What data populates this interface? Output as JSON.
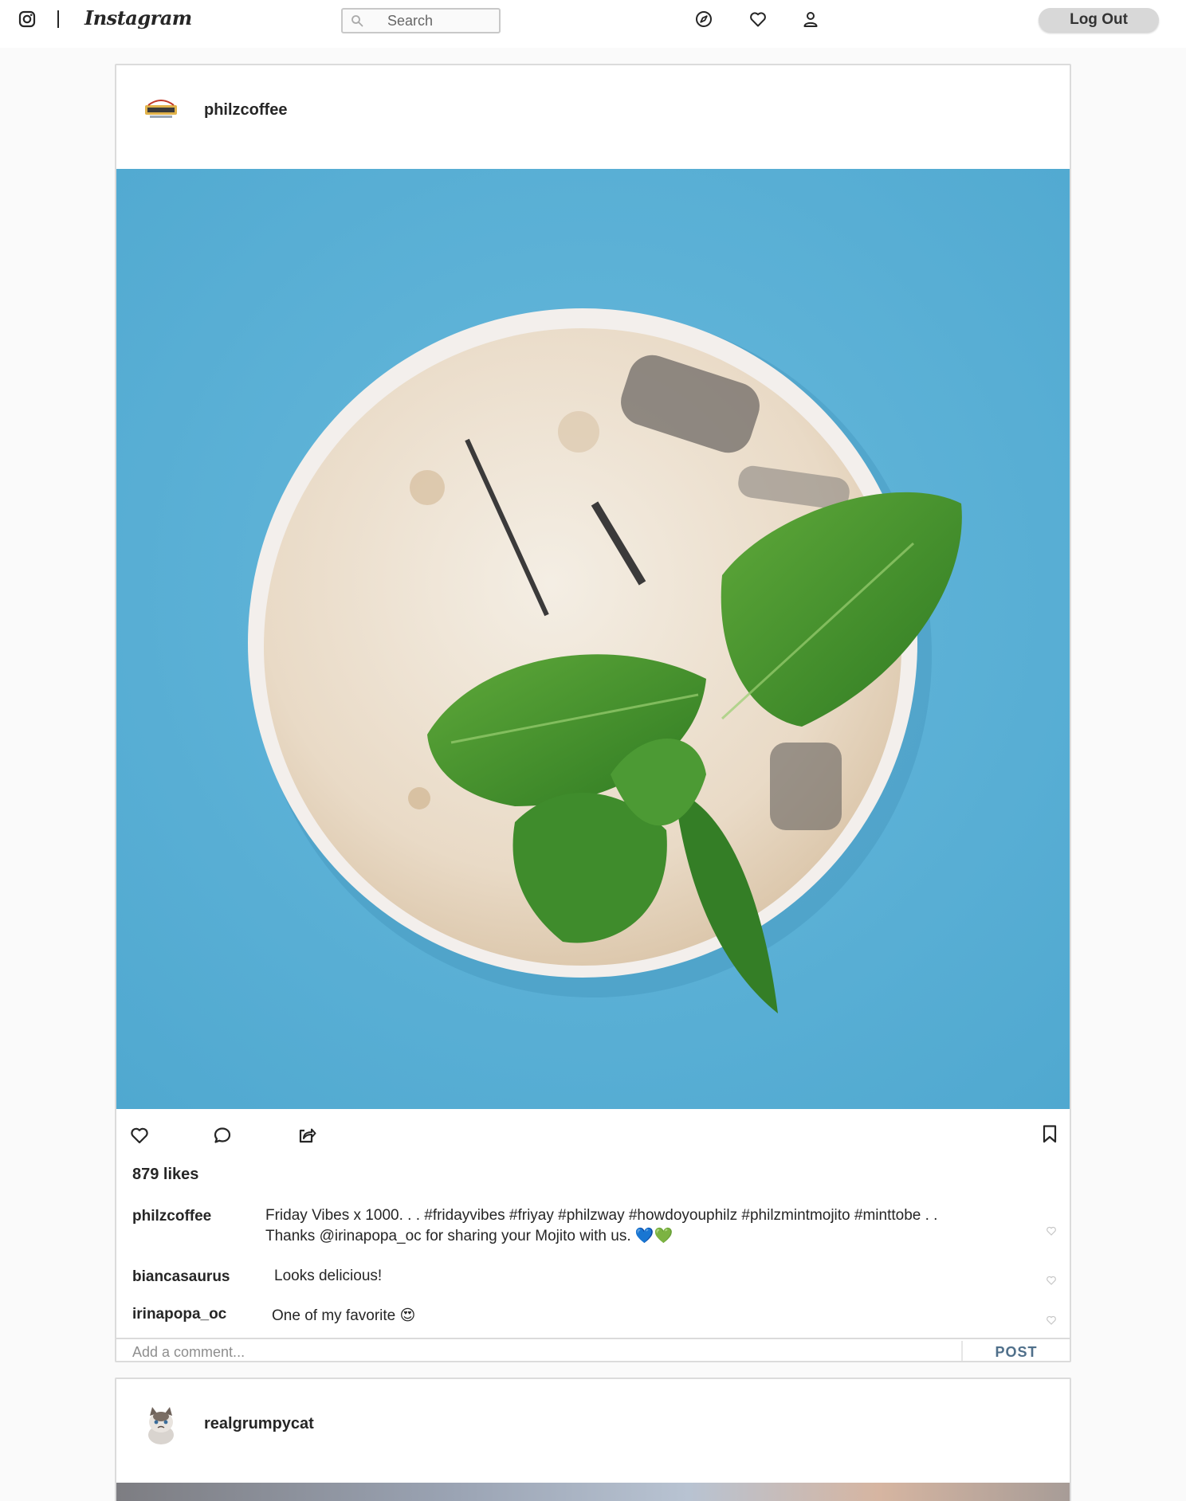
{
  "nav": {
    "brand": "Instagram",
    "search_placeholder": "Search",
    "icons": [
      "camera-icon",
      "compass-icon",
      "heart-icon",
      "user-icon"
    ],
    "logout_label": "Log Out"
  },
  "posts": [
    {
      "username": "philzcoffee",
      "likes": "879 likes",
      "comments": [
        {
          "user": "philzcoffee",
          "line1": "Friday Vibes x 1000. . . #fridayvibes #friyay #philzway #howdoyouphilz #philzmintmojito #minttobe . .",
          "line2": "Thanks @irinapopa_oc for sharing your Mojito with us. 💙💚"
        },
        {
          "user": "biancasaurus",
          "text": "Looks delicious!"
        },
        {
          "user": "irinapopa_oc",
          "text": "One of my favorite 😍"
        }
      ],
      "comment_placeholder": "Add a comment...",
      "post_label": "POST"
    },
    {
      "username": "realgrumpycat"
    }
  ],
  "colors": {
    "page_bg": "#fafafa",
    "border": "#dbdbdb",
    "image_bg": "#5aaed2",
    "post_button": "#4f6f8a"
  }
}
